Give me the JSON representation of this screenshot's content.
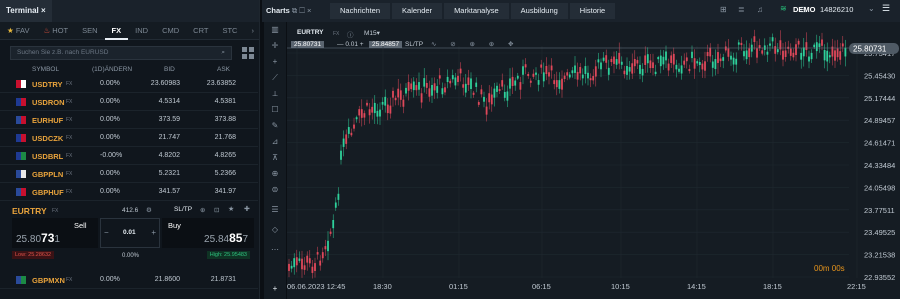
{
  "terminal": {
    "title": "Terminal",
    "close": "×",
    "tabs": [
      "FAV",
      "HOT",
      "SEN",
      "FX",
      "IND",
      "CMD",
      "CRT",
      "STC"
    ],
    "search_placeholder": "Suchen Sie z.B. nach EURUSD",
    "cols": [
      "SYMBOL",
      "(1D)ÄNDERN",
      "BID",
      "ASK"
    ],
    "rows": [
      {
        "sym": "USDTRY",
        "tag": "FX",
        "chg": "0.00%",
        "bid": "23.60983",
        "ask": "23.63852"
      },
      {
        "sym": "USDRON",
        "tag": "FX",
        "chg": "0.00%",
        "bid": "4.5314",
        "ask": "4.5381"
      },
      {
        "sym": "EURHUF",
        "tag": "FX",
        "chg": "0.00%",
        "bid": "373.59",
        "ask": "373.88"
      },
      {
        "sym": "USDCZK",
        "tag": "FX",
        "chg": "0.00%",
        "bid": "21.747",
        "ask": "21.768"
      },
      {
        "sym": "USDBRL",
        "tag": "FX",
        "chg": "-0.00%",
        "bid": "4.8202",
        "ask": "4.8265"
      },
      {
        "sym": "GBPPLN",
        "tag": "FX",
        "chg": "0.00%",
        "bid": "5.2321",
        "ask": "5.2366"
      },
      {
        "sym": "GBPHUF",
        "tag": "FX",
        "chg": "0.00%",
        "bid": "341.57",
        "ask": "341.97"
      }
    ],
    "trade": {
      "symbol": "EURTRY",
      "tag": "FX",
      "spread": "412.6",
      "sltp": "SL/TP",
      "sell": "Sell",
      "buy": "Buy",
      "sell_a": "25.80",
      "sell_b": "73",
      "sell_c": "1",
      "buy_a": "25.84",
      "buy_b": "85",
      "buy_c": "7",
      "qty": "0.01",
      "low": "Low: 25.28632",
      "chg": "0.00%",
      "high": "High: 25.95483"
    },
    "last_row": {
      "sym": "GBPMXN",
      "tag": "FX",
      "chg": "0.00%",
      "bid": "21.8600",
      "ask": "21.8731"
    }
  },
  "topbar": {
    "charts": "Charts",
    "tabs": [
      "Nachrichten",
      "Kalender",
      "Marktanalyse",
      "Ausbildung",
      "Historie"
    ],
    "demo": "DEMO",
    "account": "14826210"
  },
  "chart": {
    "symbol": "EURTRY",
    "tag": "FX",
    "timeframe": "M15",
    "sell_price": "25.80731",
    "qty": "0.01",
    "buy_price": "25.84857",
    "sltp": "SL/TP",
    "timer": "00m 00s",
    "price_label": "25.80731",
    "y_labels": [
      "25.73417",
      "25.45430",
      "25.17444",
      "24.89457",
      "24.61471",
      "24.33484",
      "24.05498",
      "23.77511",
      "23.49525",
      "23.21538",
      "22.93552"
    ],
    "x_labels": [
      "06.06.2023 12:45",
      "18:30",
      "01:15",
      "06:15",
      "10:15",
      "14:15",
      "18:15",
      "22:15"
    ]
  }
}
